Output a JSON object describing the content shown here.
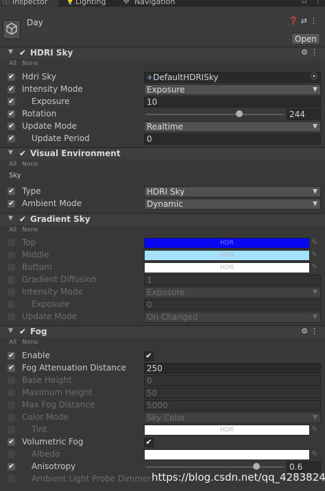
{
  "tabs": [
    {
      "label": "Inspector",
      "icon": "info-icon"
    },
    {
      "label": "Lighting",
      "icon": "bulb-icon"
    },
    {
      "label": "Navigation",
      "icon": "navigation-icon"
    }
  ],
  "header": {
    "object_name": "Day",
    "open_label": "Open"
  },
  "sections": {
    "hdri": {
      "title": "HDRI Sky",
      "all": "All",
      "none": "None",
      "rows": {
        "hdri_sky": {
          "label": "Hdri Sky",
          "value": "DefaultHDRISky",
          "enabled": true
        },
        "intensity_mode": {
          "label": "Intensity Mode",
          "value": "Exposure",
          "enabled": true
        },
        "exposure": {
          "label": "Exposure",
          "value": "10",
          "enabled": true
        },
        "rotation": {
          "label": "Rotation",
          "value": "244",
          "fraction": 0.68,
          "enabled": true
        },
        "update_mode": {
          "label": "Update Mode",
          "value": "Realtime",
          "enabled": true
        },
        "update_period": {
          "label": "Update Period",
          "value": "0",
          "enabled": true
        }
      }
    },
    "visual_env": {
      "title": "Visual Environment",
      "all": "All",
      "none": "None",
      "sub": "Sky",
      "rows": {
        "type": {
          "label": "Type",
          "value": "HDRI Sky",
          "enabled": true
        },
        "ambient_mode": {
          "label": "Ambient Mode",
          "value": "Dynamic",
          "enabled": true
        }
      }
    },
    "gradient": {
      "title": "Gradient Sky",
      "all": "All",
      "none": "None",
      "rows": {
        "top": {
          "label": "Top",
          "value": "HDR",
          "color": "#0707f0",
          "enabled": false
        },
        "middle": {
          "label": "Middle",
          "value": "HDR",
          "color": "#a4e1fb",
          "enabled": false
        },
        "bottom": {
          "label": "Bottom",
          "value": "HDR",
          "color": "#ffffff",
          "enabled": false
        },
        "gradient_diffusion": {
          "label": "Gradient Diffusion",
          "value": "1",
          "enabled": false
        },
        "intensity_mode": {
          "label": "Intensity Mode",
          "value": "Exposure",
          "enabled": false
        },
        "exposure": {
          "label": "Exposure",
          "value": "0",
          "enabled": false
        },
        "update_mode": {
          "label": "Update Mode",
          "value": "On Changed",
          "enabled": false
        }
      }
    },
    "fog": {
      "title": "Fog",
      "all": "All",
      "none": "None",
      "rows": {
        "enable": {
          "label": "Enable",
          "checked": true,
          "enabled": true
        },
        "fog_attenuation": {
          "label": "Fog Attenuation Distance",
          "value": "250",
          "enabled": true
        },
        "base_height": {
          "label": "Base Height",
          "value": "0",
          "enabled": false
        },
        "maximum_height": {
          "label": "Maximum Height",
          "value": "50",
          "enabled": false
        },
        "max_fog_distance": {
          "label": "Max Fog Distance",
          "value": "5000",
          "enabled": false
        },
        "color_mode": {
          "label": "Color Mode",
          "value": "Sky Color",
          "enabled": false
        },
        "tint": {
          "label": "Tint",
          "value": "HDR",
          "color": "#ffffff",
          "enabled": false
        },
        "volumetric_fog": {
          "label": "Volumetric Fog",
          "checked": true,
          "enabled": true
        },
        "albedo": {
          "label": "Albedo",
          "color": "#ffffff",
          "enabled": false
        },
        "anisotropy": {
          "label": "Anisotropy",
          "value": "0.6",
          "fraction": 0.8,
          "enabled": true
        },
        "ambient_probe_dimmer": {
          "label": "Ambient Light Probe Dimmer",
          "enabled": false
        }
      }
    }
  },
  "watermark": "https://blog.csdn.net/qq_42838242"
}
